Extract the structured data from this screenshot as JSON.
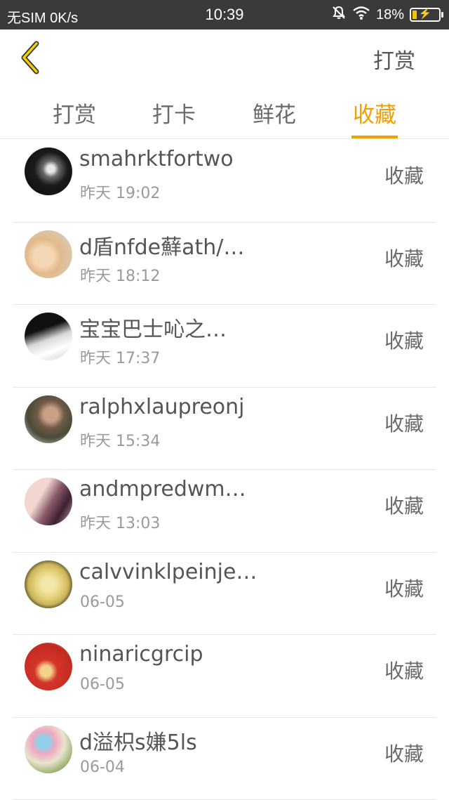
{
  "status_bar": {
    "carrier": "无SIM 0K/s",
    "time": "10:39",
    "battery": "18%",
    "battery_level": 0.18
  },
  "header": {
    "back_icon": "chevron-left-icon",
    "action_label": "打赏"
  },
  "tabs": [
    {
      "label": "打赏",
      "active": false
    },
    {
      "label": "打卡",
      "active": false
    },
    {
      "label": "鲜花",
      "active": false
    },
    {
      "label": "收藏",
      "active": true
    }
  ],
  "colors": {
    "accent": "#f2a000",
    "status_bar_bg": "#3a3a3a",
    "text_primary": "#555555",
    "text_secondary": "#9a9a9a"
  },
  "items": [
    {
      "name": "smahrktfortwo",
      "time": "昨天 19:02",
      "action": "收藏"
    },
    {
      "name": "d盾nfde蘚ath/…",
      "time": "昨天 18:12",
      "action": "收藏"
    },
    {
      "name": "宝宝巴士吣之…",
      "time": "昨天 17:37",
      "action": "收藏"
    },
    {
      "name": "ralphxlaupreonj",
      "time": "昨天 15:34",
      "action": "收藏"
    },
    {
      "name": "andmpredwm…",
      "time": "昨天 13:03",
      "action": "收藏"
    },
    {
      "name": "calvvinklpeinje…",
      "time": "06-05",
      "action": "收藏"
    },
    {
      "name": "ninaricgrcip",
      "time": "06-05",
      "action": "收藏"
    },
    {
      "name": "d溢枳s嫌5ls",
      "time": "06-04",
      "action": "收藏"
    }
  ]
}
